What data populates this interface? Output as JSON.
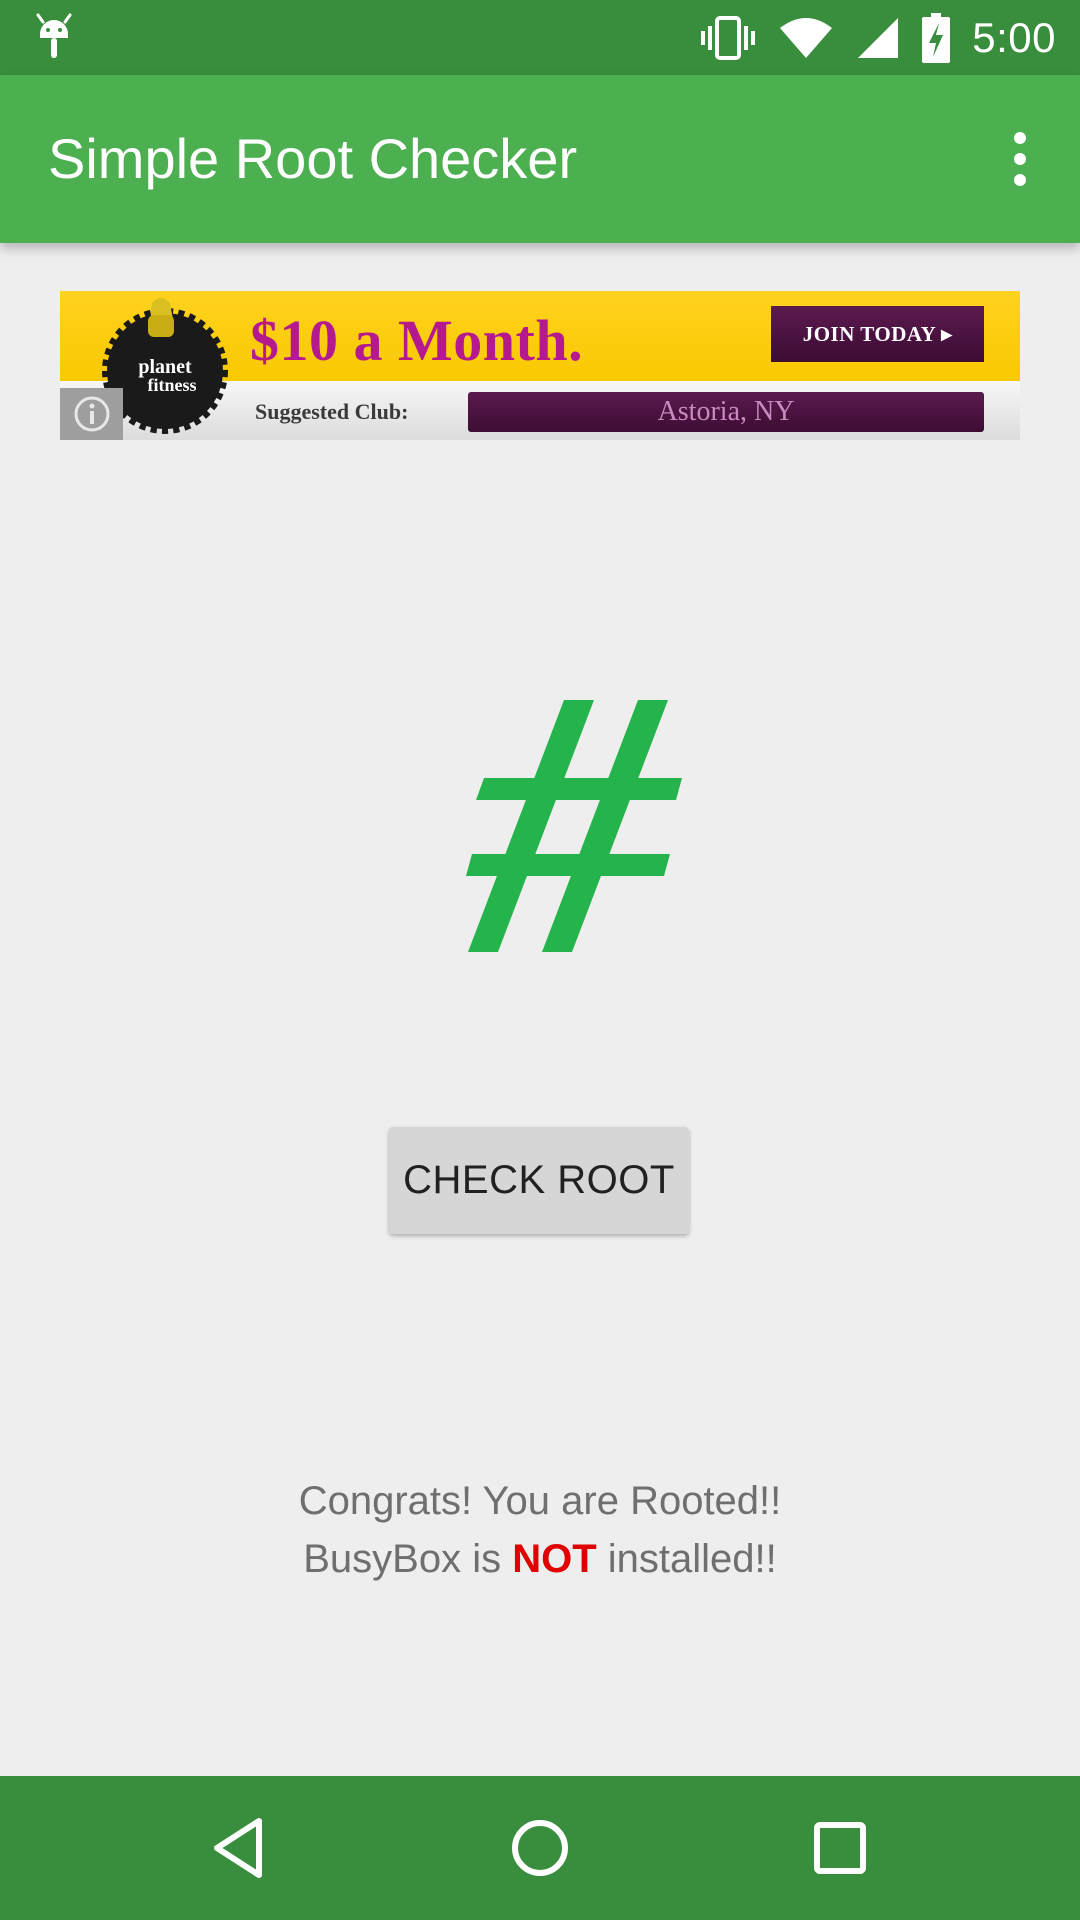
{
  "status_bar": {
    "time": "5:00",
    "icons": [
      "android-debug-icon",
      "vibrate-icon",
      "wifi-icon",
      "signal-icon",
      "battery-charging-icon"
    ]
  },
  "app_bar": {
    "title": "Simple Root Checker",
    "menu_icon": "more-vert-icon"
  },
  "ad": {
    "headline": "$10 a Month.",
    "cta": "JOIN TODAY ▸",
    "suggested_label": "Suggested Club:",
    "location": "Astoria, NY",
    "logo_text": [
      "planet",
      "fitness"
    ],
    "info_icon": "info-icon",
    "colors": {
      "banner": "#ffd21f",
      "headline": "#b5198f",
      "button": "#4a1340"
    }
  },
  "main": {
    "root_symbol": "hash-icon",
    "root_symbol_color": "#25b34b",
    "check_button_label": "CHECK ROOT",
    "result_line1": "Congrats! You are Rooted!!",
    "result_line2_prefix": "BusyBox is ",
    "result_line2_highlight": "NOT",
    "result_line2_suffix": " installed!!",
    "highlight_color": "#e00000"
  },
  "nav_bar": {
    "buttons": [
      "back-icon",
      "home-icon",
      "recents-icon"
    ]
  },
  "colors": {
    "status_bar": "#388e3c",
    "app_bar": "#4caf50",
    "background": "#eeeeee"
  }
}
